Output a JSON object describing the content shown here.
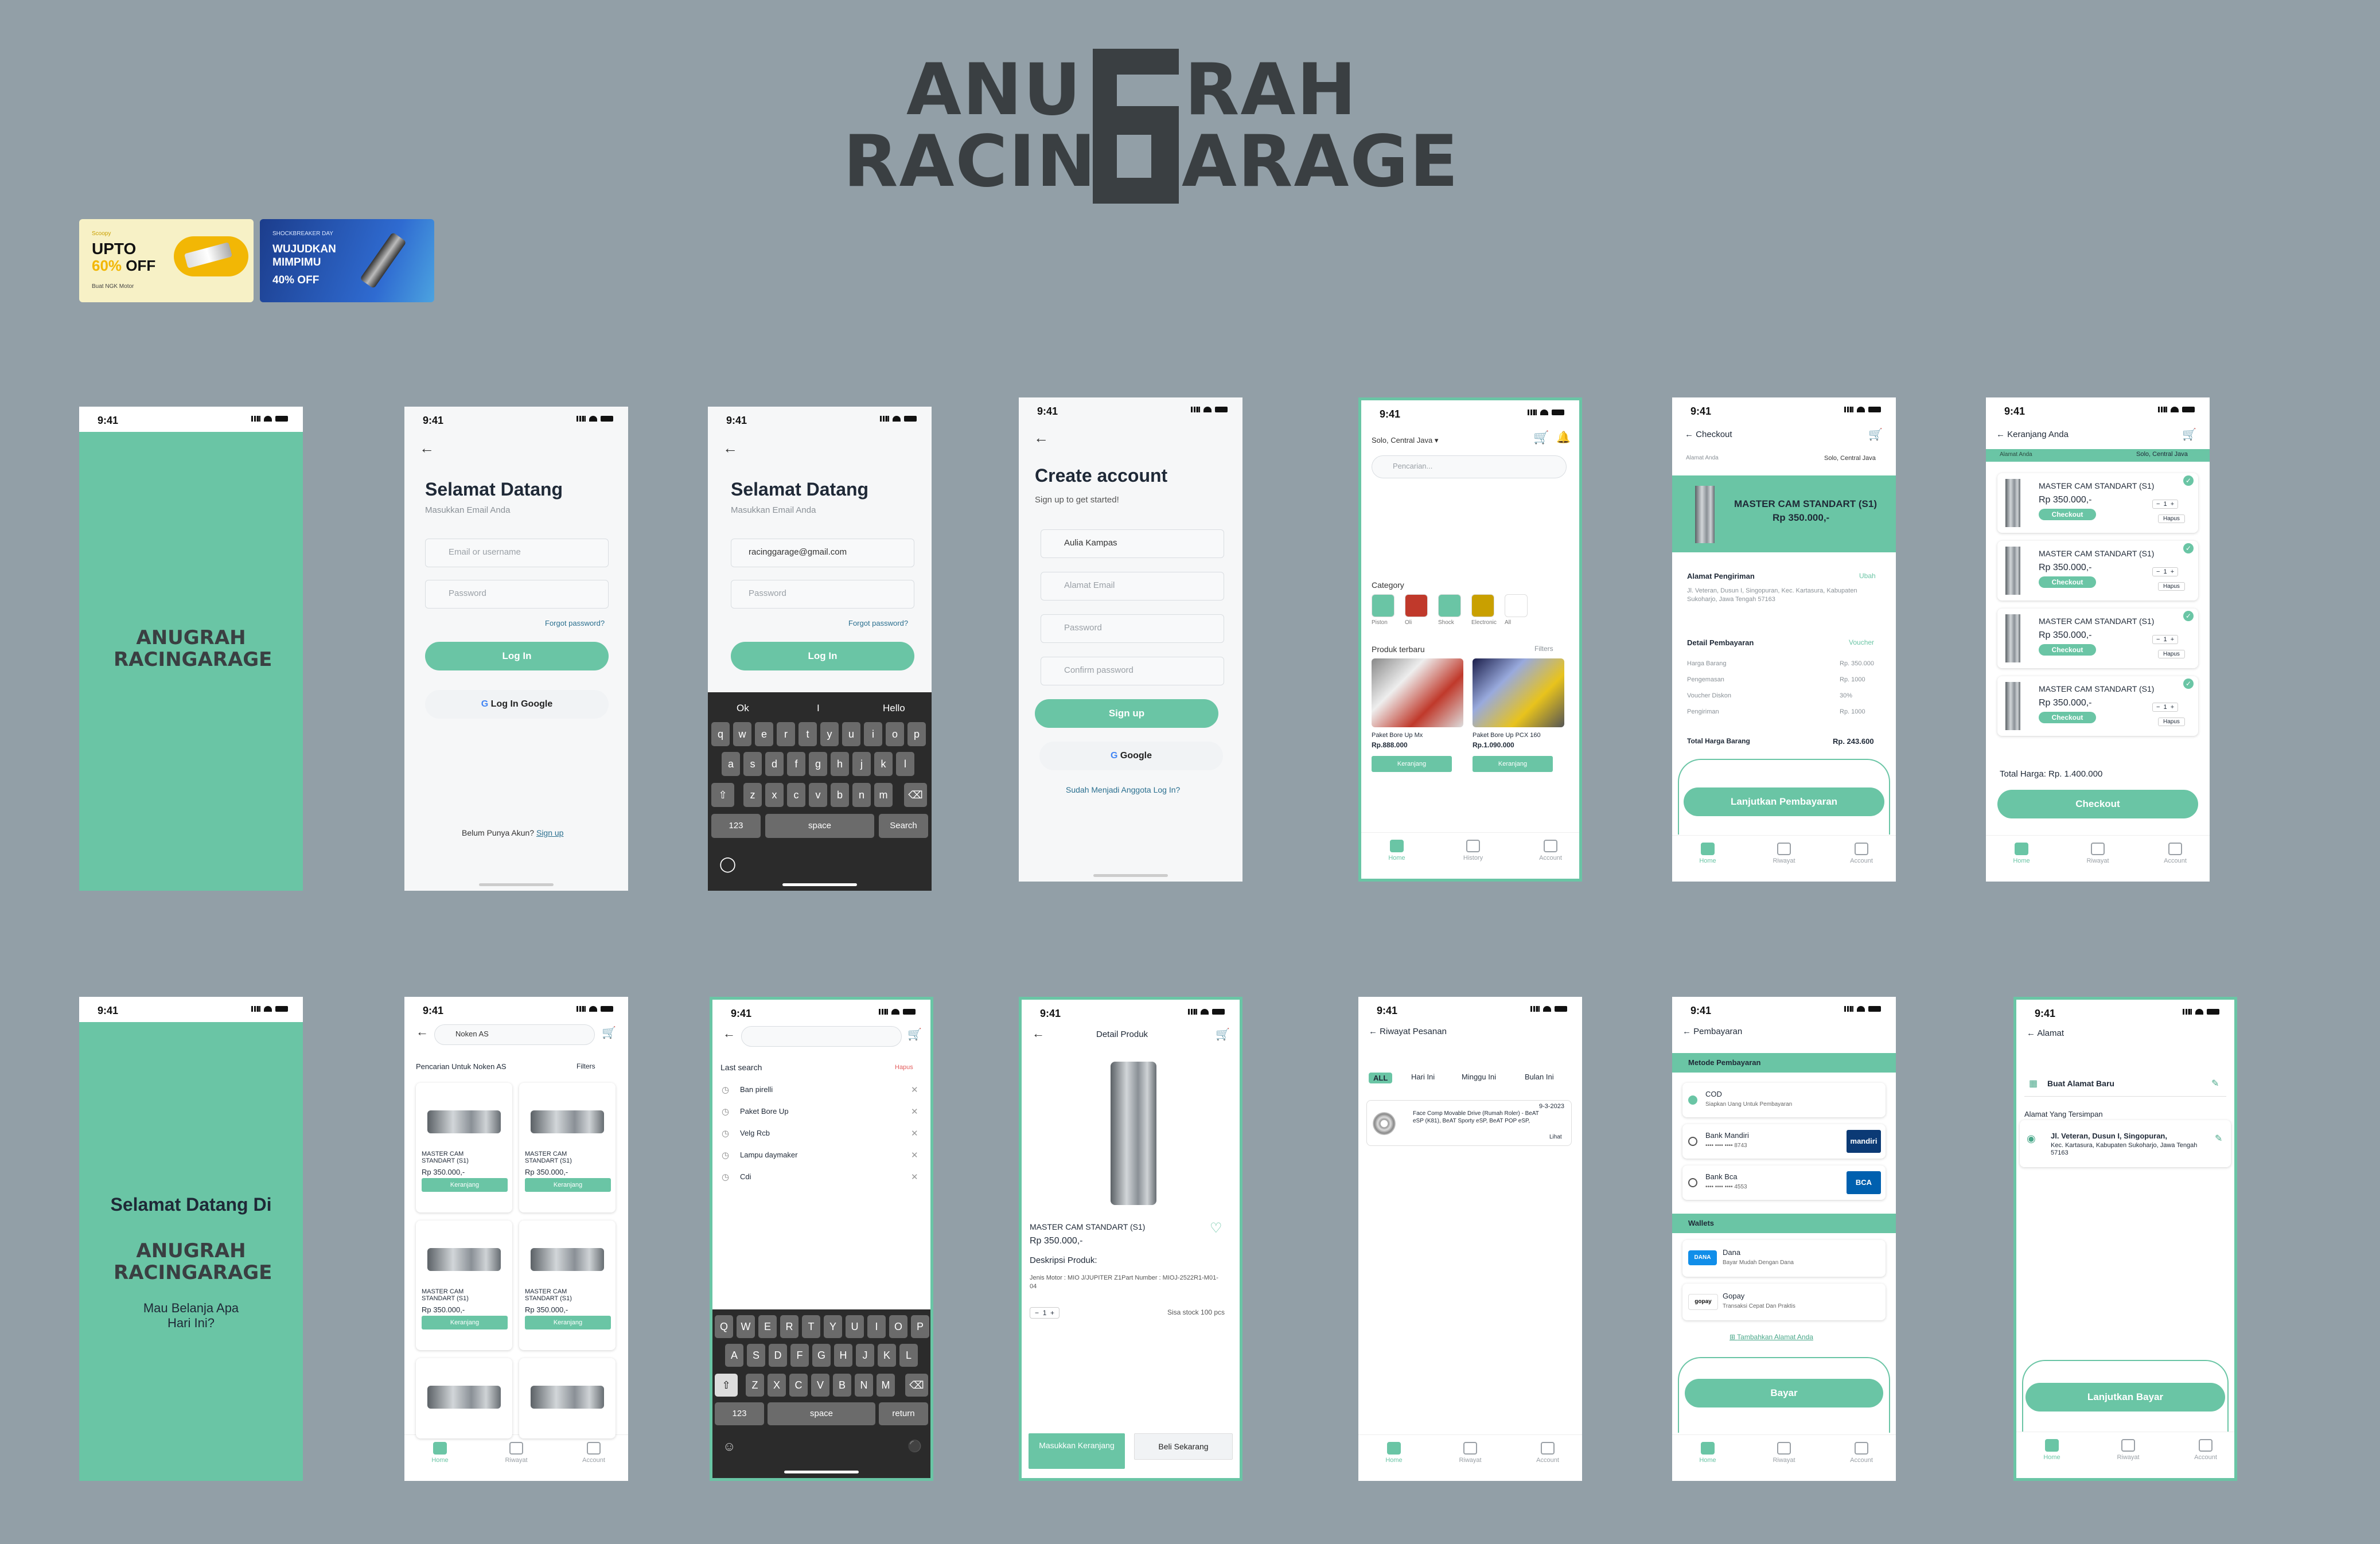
{
  "brand": {
    "line1_left": "ANU",
    "line1_right": "RAH",
    "line2_left": "RACIN",
    "line2_right": "ARAGE"
  },
  "colors": {
    "accent": "#6ac5a5",
    "background": "#929fa7",
    "logo": "#3a3f42"
  },
  "banners": [
    {
      "top": "Scoopy",
      "big1": "UPTO",
      "big2": "60%",
      "big3": "OFF",
      "sub": "Buat NGK Motor"
    },
    {
      "top": "SHOCKBREAKER DAY",
      "big1": "WUJUDKAN",
      "big2": "MIMPIMU",
      "big3": "40% OFF"
    }
  ],
  "status": {
    "time": "9:41"
  },
  "splash": {
    "logo_small": "ANUGRAH RACINGARAGE"
  },
  "login": {
    "title": "Selamat Datang",
    "subtitle": "Masukkan Email Anda",
    "email_placeholder": "Email or username",
    "password_placeholder": "Password",
    "forgot": "Forgot password?",
    "login_btn": "Log In",
    "google_btn": "Log In Google",
    "no_account": "Belum Punya Akun?",
    "signup_link": "Sign up"
  },
  "login2": {
    "email_value": "racinggarage@gmail.com",
    "suggest": [
      "Ok",
      "I",
      "Hello"
    ],
    "keys_row1": [
      "q",
      "w",
      "e",
      "r",
      "t",
      "y",
      "u",
      "i",
      "o",
      "p"
    ],
    "keys_row2": [
      "a",
      "s",
      "d",
      "f",
      "g",
      "h",
      "j",
      "k",
      "l"
    ],
    "keys_row3": [
      "z",
      "x",
      "c",
      "v",
      "b",
      "n",
      "m"
    ],
    "k123": "123",
    "space": "space",
    "search": "Search"
  },
  "signup": {
    "title": "Create account",
    "subtitle": "Sign up to get started!",
    "name_value": "Aulia Kampas",
    "email_placeholder": "Alamat Email",
    "password_placeholder": "Password",
    "confirm_placeholder": "Confirm password",
    "signup_btn": "Sign up",
    "google_btn": "Google",
    "member": "Sudah Menjadi Anggota Log In?"
  },
  "home": {
    "location": "Solo, Central Java",
    "search_placeholder": "Pencarian...",
    "category_title": "Category",
    "categories": [
      "Piston",
      "Oli",
      "Shock",
      "Electronic",
      "All"
    ],
    "products_title": "Produk terbaru",
    "filters": "Filters",
    "products": [
      {
        "name": "Paket Bore Up Mx",
        "price": "Rp.888.000",
        "btn": "Keranjang"
      },
      {
        "name": "Paket Bore Up PCX 160",
        "price": "Rp.1.090.000",
        "btn": "Keranjang"
      }
    ],
    "tabs": [
      "Home",
      "History",
      "Account"
    ]
  },
  "checkout": {
    "title": "Checkout",
    "addr_label": "Alamat Anda",
    "location": "Solo, Central Java",
    "product": "MASTER CAM STANDART (S1)",
    "price": "Rp 350.000,-",
    "ship_title": "Alamat Pengiriman",
    "ubah": "Ubah",
    "address": "Jl. Veteran, Dusun I, Singopuran, Kec. Kartasura, Kabupaten Sukoharjo, Jawa Tengah 57163",
    "pay_title": "Detail Pembayaran",
    "voucher": "Voucher",
    "rows": [
      [
        "Harga Barang",
        "Rp. 350.000"
      ],
      [
        "Pengemasan",
        "Rp. 1000"
      ],
      [
        "Voucher Diskon",
        "30%"
      ],
      [
        "Pengiriman",
        "Rp. 1000"
      ]
    ],
    "total_label": "Total Harga Barang",
    "total": "Rp. 243.600",
    "btn": "Lanjutkan Pembayaran",
    "tabs": [
      "Home",
      "Riwayat",
      "Account"
    ]
  },
  "cart": {
    "title": "Keranjang Anda",
    "addr_label": "Alamat Anda",
    "location": "Solo, Central Java",
    "items": [
      {
        "name": "MASTER CAM STANDART (S1)",
        "price": "Rp 350.000,-",
        "qty": "1",
        "checkout": "Checkout",
        "hapus": "Hapus"
      },
      {
        "name": "MASTER CAM STANDART (S1)",
        "price": "Rp 350.000,-",
        "qty": "1",
        "checkout": "Checkout",
        "hapus": "Hapus"
      },
      {
        "name": "MASTER CAM STANDART (S1)",
        "price": "Rp 350.000,-",
        "qty": "1",
        "checkout": "Checkout",
        "hapus": "Hapus"
      },
      {
        "name": "MASTER CAM STANDART (S1)",
        "price": "Rp 350.000,-",
        "qty": "1",
        "checkout": "Checkout",
        "hapus": "Hapus"
      }
    ],
    "total": "Total Harga: Rp. 1.400.000",
    "btn": "Checkout",
    "tabs": [
      "Home",
      "Riwayat",
      "Account"
    ]
  },
  "welcome": {
    "line1": "Selamat Datang Di",
    "line2": "Mau Belanja Apa",
    "line3": "Hari Ini?"
  },
  "search_results": {
    "query": "Noken AS",
    "title": "Pencarian Untuk Noken AS",
    "filters": "Filters",
    "items": [
      {
        "name": "MASTER CAM STANDART (S1)",
        "price": "Rp 350.000,-",
        "btn": "Keranjang"
      },
      {
        "name": "MASTER CAM STANDART (S1)",
        "price": "Rp 350.000,-",
        "btn": "Keranjang"
      },
      {
        "name": "MASTER CAM STANDART (S1)",
        "price": "Rp 350.000,-",
        "btn": "Keranjang"
      },
      {
        "name": "MASTER CAM STANDART (S1)",
        "price": "Rp 350.000,-",
        "btn": "Keranjang"
      }
    ],
    "tabs": [
      "Home",
      "Riwayat",
      "Account"
    ]
  },
  "search_history": {
    "title": "Last search",
    "hapus": "Hapus",
    "items": [
      "Ban pirelli",
      "Paket Bore Up",
      "Velg Rcb",
      "Lampu daymaker",
      "Cdi"
    ],
    "keys_row1": [
      "Q",
      "W",
      "E",
      "R",
      "T",
      "Y",
      "U",
      "I",
      "O",
      "P"
    ],
    "keys_row2": [
      "A",
      "S",
      "D",
      "F",
      "G",
      "H",
      "J",
      "K",
      "L"
    ],
    "keys_row3": [
      "Z",
      "X",
      "C",
      "V",
      "B",
      "N",
      "M"
    ],
    "k123": "123",
    "space": "space",
    "ret": "return"
  },
  "detail": {
    "title": "Detail Produk",
    "name": "MASTER CAM STANDART (S1)",
    "price": "Rp 350.000,-",
    "desc_title": "Deskripsi Produk:",
    "desc": "Jenis Motor : MIO J/JUPITER Z1Part Number : MIOJ-2522R1-M01-04",
    "qty": "1",
    "stock": "Sisa stock 100 pcs",
    "btn_cart": "Masukkan Keranjang",
    "btn_buy": "Beli Sekarang"
  },
  "history": {
    "title": "Riwayat Pesanan",
    "filters": [
      "ALL",
      "Hari Ini",
      "Minggu Ini",
      "Bulan Ini"
    ],
    "order_date": "9-3-2023",
    "order_text": "Face Comp Movable Drive (Rumah Roler) - BeAT eSP (K81), BeAT Sporty eSP, BeAT POP eSP,",
    "lihat": "Lihat",
    "tabs": [
      "Home",
      "Riwayat",
      "Account"
    ]
  },
  "payment": {
    "title": "Pembayaran",
    "section1": "Metode Pembayaran",
    "methods": [
      {
        "name": "COD",
        "sub": "Siapkan Uang Untuk Pembayaran"
      },
      {
        "name": "Bank Mandiri",
        "sub": "•••• •••• •••• 8743",
        "logo": "mandiri"
      },
      {
        "name": "Bank Bca",
        "sub": "•••• •••• •••• 4553",
        "logo": "BCA"
      }
    ],
    "section2": "Wallets",
    "wallets": [
      {
        "name": "Dana",
        "sub": "Bayar Mudah Dengan Dana",
        "logo": "DANA"
      },
      {
        "name": "Gopay",
        "sub": "Transaksi Cepat Dan Praktis",
        "logo": "gopay"
      }
    ],
    "add": "Tambahkan Alamat Anda",
    "btn": "Bayar",
    "tabs": [
      "Home",
      "Riwayat",
      "Account"
    ]
  },
  "address": {
    "title": "Alamat",
    "new": "Buat Alamat Baru",
    "saved_title": "Alamat Yang Tersimpan",
    "saved_line1": "Jl. Veteran, Dusun I, Singopuran,",
    "saved_line2": "Kec. Kartasura, Kabupaten Sukoharjo, Jawa Tengah 57163",
    "btn": "Lanjutkan Bayar",
    "tabs": [
      "Home",
      "Riwayat",
      "Account"
    ]
  }
}
